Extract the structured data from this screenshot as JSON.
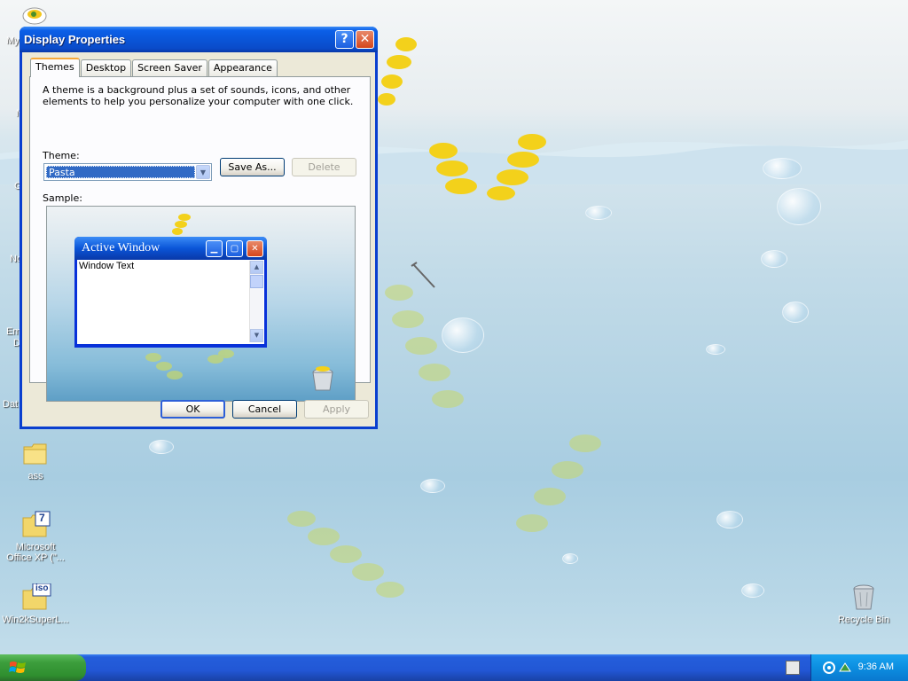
{
  "desktop": {
    "icons": [
      {
        "label": "ass"
      },
      {
        "label": "Microsoft Office XP (\"..."
      },
      {
        "label": "Win2kSuperL..."
      },
      {
        "label": "Recycle Bin"
      }
    ],
    "cut_labels": [
      "My",
      "N",
      "G",
      "No",
      "Em",
      "D",
      "Dat"
    ],
    "icon_badges": {
      "office": "7",
      "iso": "iso"
    }
  },
  "dialog": {
    "title": "Display Properties",
    "help_glyph": "?",
    "close_glyph": "✕",
    "tabs": [
      {
        "label": "Themes",
        "active": true
      },
      {
        "label": "Desktop",
        "active": false
      },
      {
        "label": "Screen Saver",
        "active": false
      },
      {
        "label": "Appearance",
        "active": false
      }
    ],
    "description": "A theme is a background plus a set of sounds, icons, and other elements to help you personalize your computer with one click.",
    "theme_label": "Theme:",
    "theme_value": "Pasta",
    "save_as_label": "Save As...",
    "delete_label": "Delete",
    "sample_label": "Sample:",
    "sample_window": {
      "title": "Active Window",
      "body_text": "Window Text"
    },
    "ok_label": "OK",
    "cancel_label": "Cancel",
    "apply_label": "Apply"
  },
  "taskbar": {
    "clock": "9:36 AM"
  },
  "colors": {
    "xp_blue": "#0a55d8",
    "start_green": "#3c9e3c",
    "desktop_water": "#a8cde1"
  }
}
